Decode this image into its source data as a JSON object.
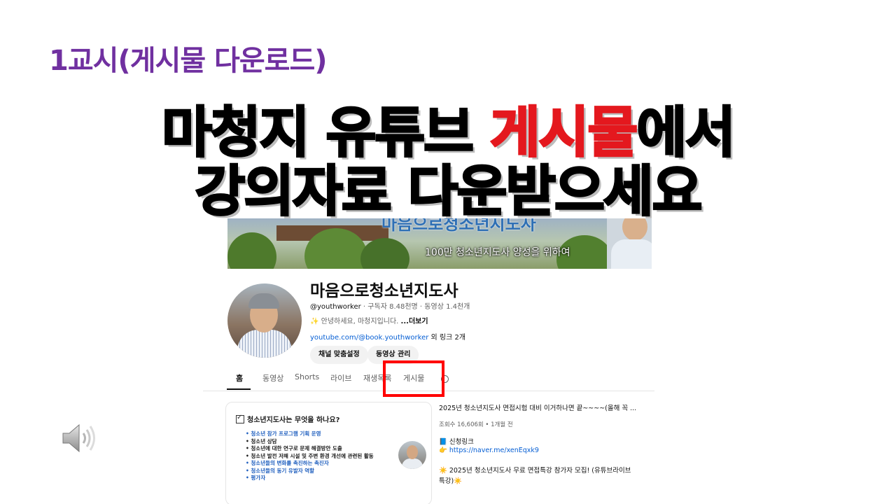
{
  "slide": {
    "label": "1교시(게시물 다운로드)",
    "headline_line1_a": "마청지 유튜브 ",
    "headline_line1_highlight": "게시물",
    "headline_line1_b": "에서",
    "headline_line2": "강의자료 다운받으세요",
    "highlight_color": "#e4181e",
    "label_color": "#7030a0"
  },
  "banner": {
    "title": "마음으로청소년지도사",
    "subtitle": "100만 청소년지도사 양성을 위하여"
  },
  "channel": {
    "name": "마음으로청소년지도사",
    "handle": "@youthworker",
    "subscribers": "구독자 8.48천명",
    "videos": "동영상 1.4천개",
    "description": "✨ 안녕하세요, 마청지입니다. ",
    "more": "...더보기",
    "link": "youtube.com/@book.youthworker",
    "link_extra": " 외 링크 2개",
    "buttons": [
      "채널 맞춤설정",
      "동영상 관리"
    ]
  },
  "tabs": [
    "홈",
    "동영상",
    "Shorts",
    "라이브",
    "재생목록",
    "게시물"
  ],
  "active_tab": "홈",
  "highlighted_tab": "게시물",
  "card": {
    "title": "청소년지도사는 무엇을 하나요?",
    "bullets": [
      "• 청소년 참가 프로그램 기획 운영",
      "• 청소년 상담",
      "• 청소년에 대한 연구로 문제 해결방안 도출",
      "• 청소년 발전 저해 시설 및 주변 환경 개선에 관련된 활동",
      "• 청소년들의 변화를 촉진하는 촉진자",
      "• 청소년들의 동기 유발자 역할",
      "• 평가자"
    ]
  },
  "post": {
    "title": "2025년 청소년지도사 면접시험 대비 이거하나면 끝~~~~(올해 꼭 ...",
    "meta": "조회수 16,606회 • 1개월 전",
    "line1": "📘 신청링크",
    "line2_icon": "👉 ",
    "line2_link": "https://naver.me/xenEqxk9",
    "line3": "☀️ 2025년 청소년지도사 무료 면접특강 참가자 모집! (유튜브라이브",
    "line4": "특강)☀️"
  }
}
